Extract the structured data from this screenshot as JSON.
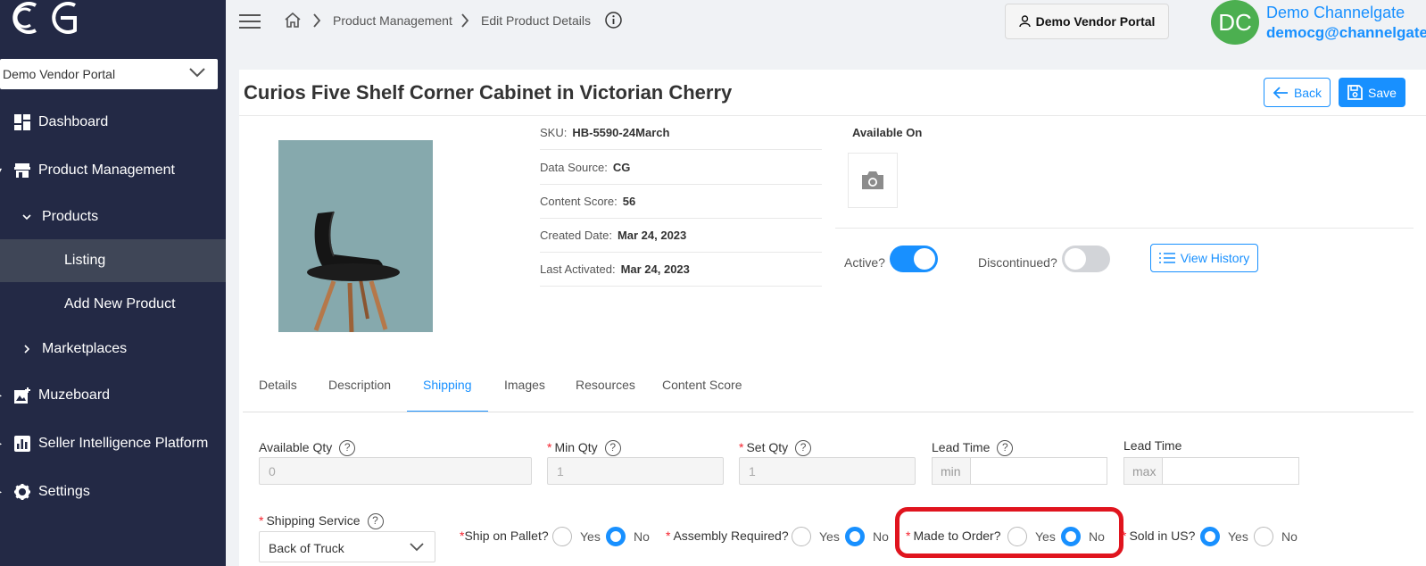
{
  "sidebar": {
    "vendor_select": "Demo Vendor Portal",
    "items": [
      {
        "label": "Dashboard"
      },
      {
        "label": "Product Management"
      },
      {
        "label": "Products"
      },
      {
        "label": "Listing"
      },
      {
        "label": "Add New Product"
      },
      {
        "label": "Marketplaces"
      },
      {
        "label": "Muzeboard"
      },
      {
        "label": "Seller Intelligence Platform"
      },
      {
        "label": "Settings"
      }
    ]
  },
  "header": {
    "breadcrumb": [
      "Product Management",
      "Edit Product Details"
    ],
    "vendor_button": "Demo Vendor Portal",
    "avatar_initials": "DC",
    "user_name": "Demo Channelgate",
    "user_email": "democg@channelgate.io"
  },
  "product": {
    "title": "Curios Five Shelf Corner Cabinet in Victorian Cherry",
    "back_label": "Back",
    "save_label": "Save",
    "info": [
      {
        "label": "SKU:",
        "value": "HB-5590-24March"
      },
      {
        "label": "Data Source:",
        "value": "CG"
      },
      {
        "label": "Content Score:",
        "value": "56"
      },
      {
        "label": "Created Date:",
        "value": "Mar 24, 2023"
      },
      {
        "label": "Last Activated:",
        "value": "Mar 24, 2023"
      }
    ],
    "available_on": "Available On",
    "active_label": "Active?",
    "active": true,
    "discontinued_label": "Discontinued?",
    "discontinued": false,
    "view_history": "View History"
  },
  "tabs": [
    "Details",
    "Description",
    "Shipping",
    "Images",
    "Resources",
    "Content Score"
  ],
  "active_tab": "Shipping",
  "shipping": {
    "available_qty": {
      "label": "Available Qty",
      "value": "0"
    },
    "min_qty": {
      "label": "Min Qty",
      "value": "1"
    },
    "set_qty": {
      "label": "Set Qty",
      "value": "1"
    },
    "lead_time_min": {
      "label": "Lead Time",
      "addon": "min",
      "value": ""
    },
    "lead_time_max": {
      "label": "Lead Time",
      "addon": "max",
      "value": ""
    },
    "shipping_service": {
      "label": "Shipping Service",
      "value": "Back of Truck"
    },
    "ship_on_pallet": {
      "label": "Ship on Pallet?",
      "value": "No"
    },
    "assembly_required": {
      "label": "Assembly Required?",
      "value": "No"
    },
    "made_to_order": {
      "label": "Made to Order?",
      "value": "No"
    },
    "sold_in_us": {
      "label": "Sold in US?",
      "value": "Yes"
    },
    "yes": "Yes",
    "no": "No"
  },
  "colors": {
    "sidebar": "#232945",
    "accent": "#1890ff",
    "highlight": "#e0141e",
    "avatar": "#4caf50"
  }
}
